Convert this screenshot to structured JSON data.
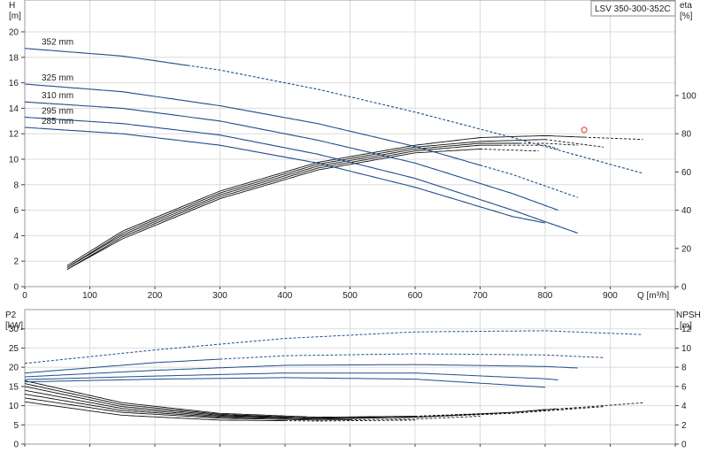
{
  "model_label": "LSV 350-300-352C",
  "colors": {
    "head": "#1f4e8c",
    "efficiency": "#111111",
    "npsh": "#111111",
    "power": "#1f4e8c",
    "marker": "#e0362c"
  },
  "chart_data": [
    {
      "id": "head-eta",
      "type": "line",
      "ylabel_left": [
        "H",
        "[m]"
      ],
      "ylabel_right": [
        "eta",
        "[%]"
      ],
      "xlabel": "Q [m³/h]",
      "xlim": [
        0,
        1000
      ],
      "x_ticks": [
        0,
        100,
        200,
        300,
        400,
        500,
        600,
        700,
        800,
        900
      ],
      "ylim_left": [
        0,
        22.5
      ],
      "y_ticks_left": [
        0,
        2,
        4,
        6,
        8,
        10,
        12,
        14,
        16,
        18,
        20
      ],
      "ylim_right": [
        0,
        150
      ],
      "y_ticks_right": [
        0,
        20,
        40,
        60,
        80,
        100
      ],
      "grid": true,
      "head_curves": [
        {
          "name": "352 mm",
          "x": [
            0,
            150,
            300,
            450,
            600,
            750,
            950
          ],
          "y": [
            18.7,
            18.1,
            17.0,
            15.5,
            13.7,
            11.7,
            8.9
          ],
          "split_x": 250
        },
        {
          "name": "325 mm",
          "x": [
            0,
            150,
            300,
            450,
            600,
            750,
            850
          ],
          "y": [
            15.9,
            15.3,
            14.2,
            12.8,
            11.0,
            8.8,
            7.0
          ],
          "split_x": 700
        },
        {
          "name": "310 mm",
          "x": [
            0,
            150,
            300,
            450,
            600,
            750,
            820
          ],
          "y": [
            14.5,
            14.0,
            13.0,
            11.5,
            9.7,
            7.3,
            6.0
          ],
          "split_x": 820
        },
        {
          "name": "295 mm",
          "x": [
            0,
            150,
            300,
            450,
            600,
            750,
            850
          ],
          "y": [
            13.3,
            12.8,
            11.9,
            10.4,
            8.5,
            6.0,
            4.2
          ],
          "split_x": 850
        },
        {
          "name": "285 mm",
          "x": [
            0,
            150,
            300,
            450,
            600,
            750,
            800
          ],
          "y": [
            12.5,
            12.0,
            11.1,
            9.7,
            7.8,
            5.5,
            5.0
          ],
          "split_x": 800
        }
      ],
      "eta_curves": [
        {
          "x": [
            65,
            150,
            300,
            450,
            600,
            700,
            800,
            950
          ],
          "y": [
            11,
            29,
            50,
            65,
            74,
            78,
            79,
            77
          ]
        },
        {
          "x": [
            65,
            150,
            300,
            450,
            600,
            700,
            800,
            890
          ],
          "y": [
            10,
            28,
            49,
            64,
            73,
            76,
            77,
            73
          ]
        },
        {
          "x": [
            65,
            150,
            300,
            450,
            600,
            700,
            800,
            850
          ],
          "y": [
            10,
            27,
            48,
            63,
            72,
            75,
            75,
            74
          ]
        },
        {
          "x": [
            65,
            150,
            300,
            450,
            600,
            700,
            800,
            820
          ],
          "y": [
            9,
            26,
            47,
            62,
            71,
            74,
            74,
            72
          ]
        },
        {
          "x": [
            65,
            150,
            300,
            450,
            600,
            700,
            790
          ],
          "y": [
            9,
            25,
            46,
            61,
            70,
            72,
            71
          ]
        }
      ],
      "duty_point": {
        "x": 860,
        "y": 12.3
      }
    },
    {
      "id": "power-npsh",
      "type": "line",
      "ylabel_left": [
        "P2",
        "[kW]"
      ],
      "ylabel_right": [
        "NPSH",
        "[m]"
      ],
      "xlim": [
        0,
        1000
      ],
      "ylim_left": [
        0,
        35
      ],
      "y_ticks_left": [
        0,
        5,
        10,
        15,
        20,
        25,
        30
      ],
      "ylim_right": [
        0,
        14
      ],
      "y_ticks_right": [
        0,
        2,
        4,
        6,
        8,
        10,
        12
      ],
      "grid": true,
      "power_curves": [
        {
          "x": [
            0,
            200,
            400,
            600,
            800,
            950
          ],
          "y": [
            21,
            24.5,
            27.5,
            29.2,
            29.5,
            28.5
          ],
          "split_x": 0
        },
        {
          "x": [
            0,
            200,
            400,
            600,
            800,
            890
          ],
          "y": [
            18.5,
            21.2,
            23.0,
            23.5,
            23.2,
            22.5
          ],
          "split_x": 300
        },
        {
          "x": [
            0,
            200,
            400,
            600,
            800,
            850
          ],
          "y": [
            17.5,
            19.2,
            20.5,
            20.7,
            20.2,
            19.8
          ],
          "split_x": 850
        },
        {
          "x": [
            0,
            200,
            400,
            600,
            800,
            820
          ],
          "y": [
            16.8,
            17.7,
            18.5,
            18.5,
            17.0,
            16.7
          ],
          "split_x": 820
        },
        {
          "x": [
            0,
            200,
            400,
            600,
            800
          ],
          "y": [
            16.2,
            16.9,
            17.3,
            16.9,
            14.8
          ],
          "split_x": 800
        }
      ],
      "npsh_curves": [
        {
          "x": [
            0,
            150,
            300,
            450,
            600,
            750,
            950
          ],
          "y": [
            6.6,
            4.3,
            3.2,
            2.8,
            2.9,
            3.3,
            4.3
          ],
          "split_x": 600
        },
        {
          "x": [
            0,
            150,
            300,
            450,
            600,
            750,
            890
          ],
          "y": [
            6.3,
            4.1,
            3.1,
            2.7,
            2.8,
            3.2,
            3.9
          ],
          "split_x": 600
        },
        {
          "x": [
            0,
            150,
            300,
            450,
            600,
            750,
            850
          ],
          "y": [
            6.0,
            3.9,
            3.0,
            2.7,
            2.8,
            3.3,
            3.8
          ],
          "split_x": 620
        },
        {
          "x": [
            0,
            150,
            300,
            450,
            600,
            750,
            820
          ],
          "y": [
            5.6,
            3.7,
            2.9,
            2.7,
            2.8,
            3.3,
            3.7
          ],
          "split_x": 650
        },
        {
          "x": [
            0,
            150,
            300,
            450,
            600,
            750,
            800
          ],
          "y": [
            5.2,
            3.5,
            2.8,
            2.6,
            2.8,
            3.3,
            3.6
          ],
          "split_x": 680
        },
        {
          "x": [
            0,
            150,
            300,
            450,
            600,
            700
          ],
          "y": [
            4.8,
            3.3,
            2.7,
            2.5,
            2.6,
            2.9
          ],
          "split_x": 500
        },
        {
          "x": [
            0,
            150,
            300,
            450,
            600
          ],
          "y": [
            4.4,
            3.0,
            2.5,
            2.4,
            2.5
          ],
          "split_x": 400
        }
      ]
    }
  ]
}
